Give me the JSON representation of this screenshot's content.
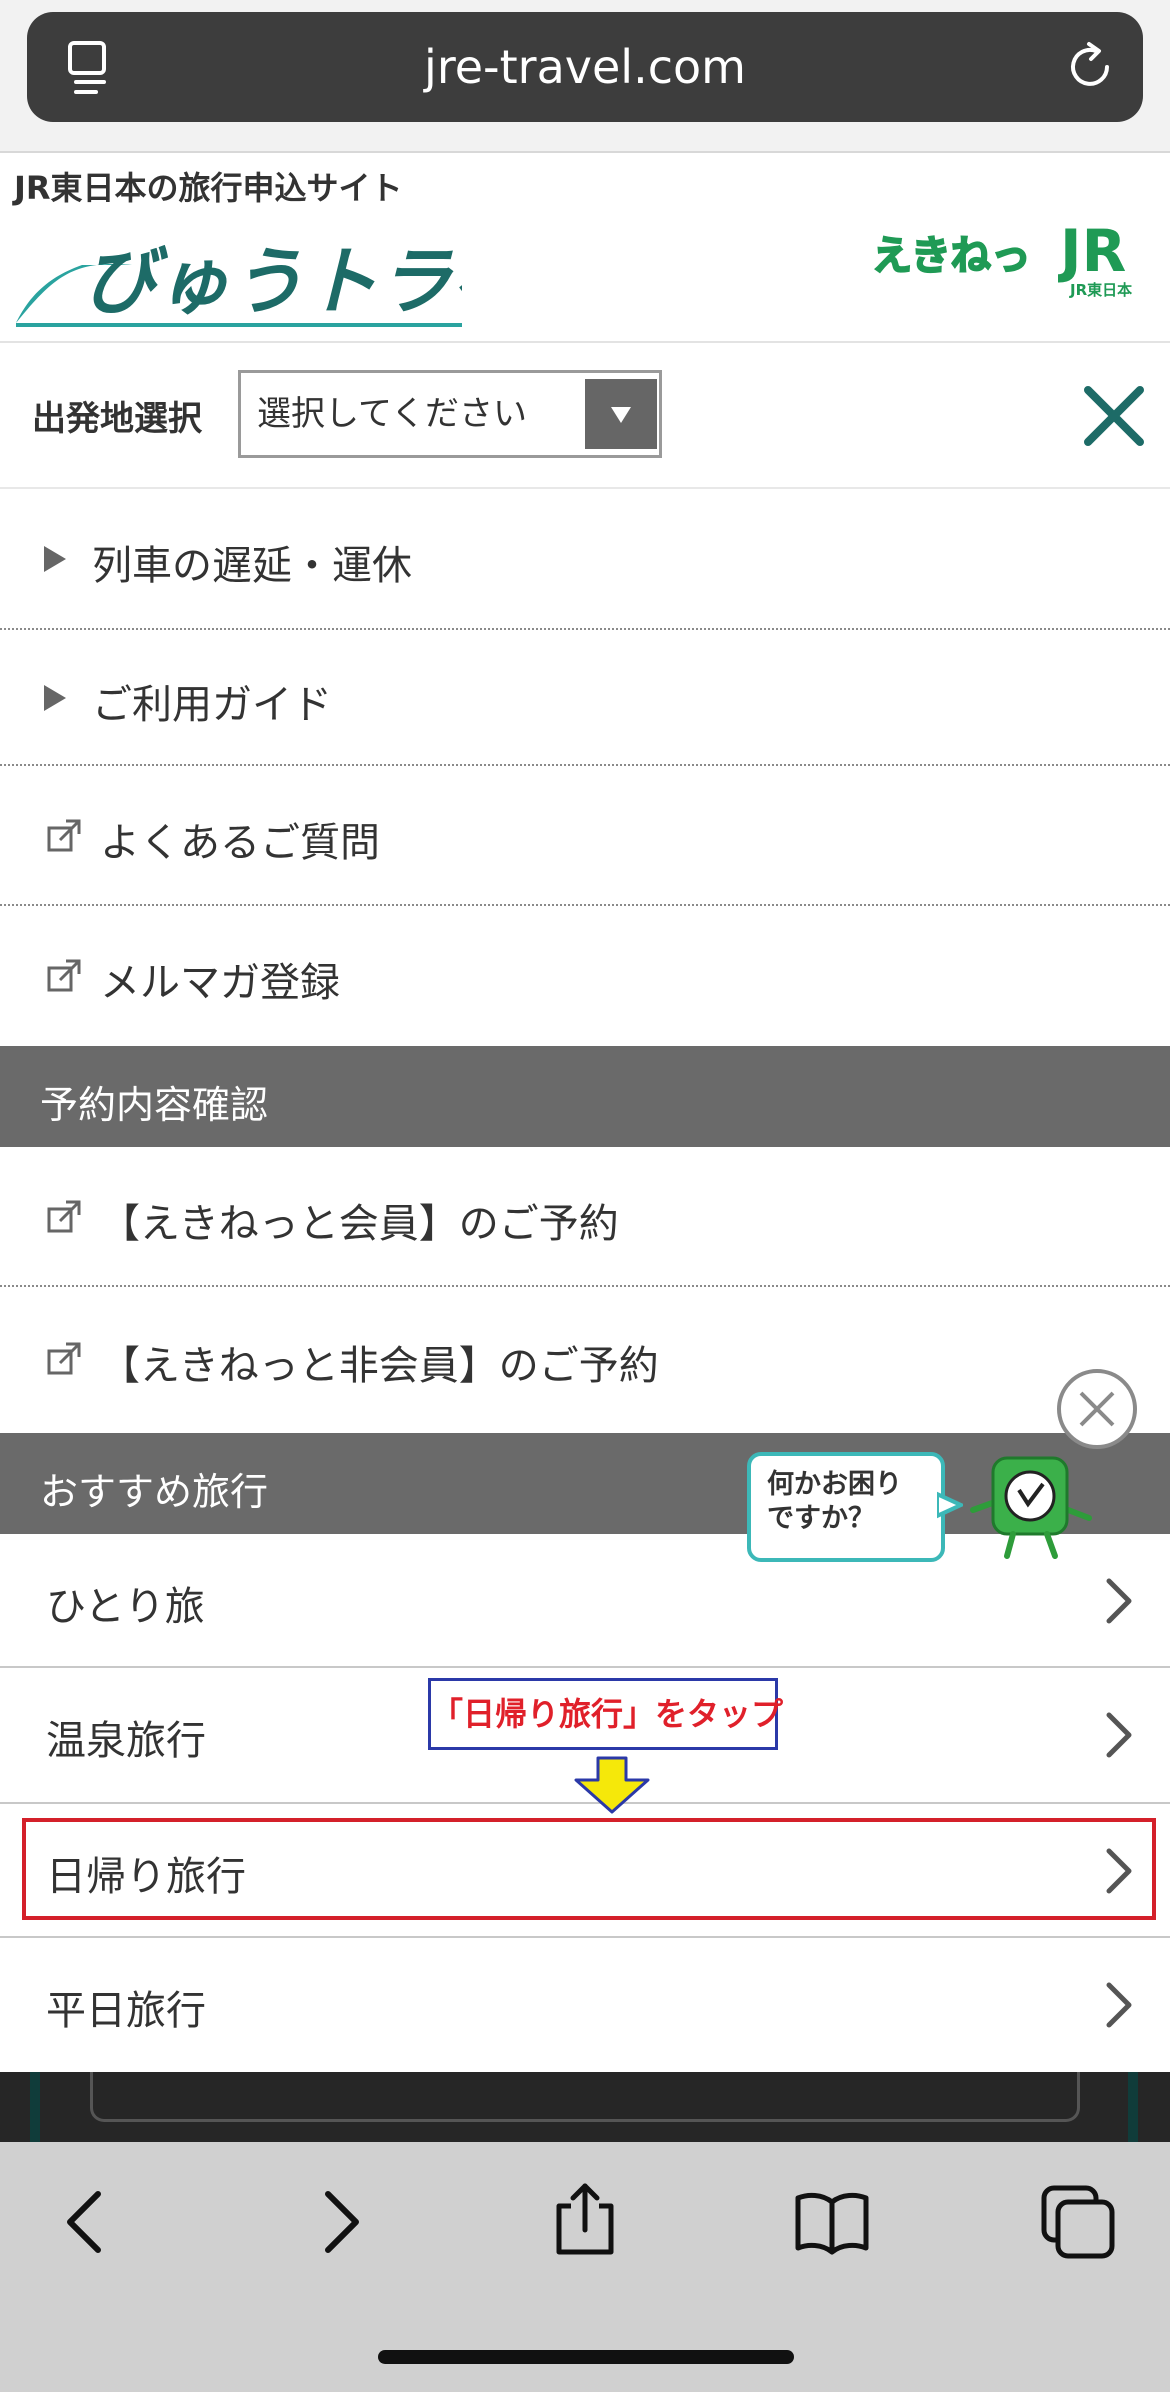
{
  "browser": {
    "url": "jre-travel.com"
  },
  "site_header": {
    "tagline": "JR東日本の旅行申込サイト",
    "logo_text": "びゅうトラベル",
    "ekinet_logo_text": "えきねっと",
    "jr_logo_text": "JR",
    "jr_logo_sub": "JR東日本"
  },
  "departure": {
    "label": "出発地選択",
    "select_value": "選択してください"
  },
  "menu_links": [
    {
      "label": "列車の遅延・運休",
      "icon": "triangle-right-icon"
    },
    {
      "label": "ご利用ガイド",
      "icon": "triangle-right-icon"
    },
    {
      "label": "よくあるご質問",
      "icon": "external-link-icon"
    },
    {
      "label": "メルマガ登録",
      "icon": "external-link-icon"
    }
  ],
  "reservation_section": {
    "title": "予約内容確認",
    "items": [
      {
        "label": "【えきねっと会員】のご予約",
        "icon": "external-link-icon"
      },
      {
        "label": "【えきねっと非会員】のご予約",
        "icon": "external-link-icon"
      }
    ]
  },
  "recommend_section": {
    "title": "おすすめ旅行",
    "items": [
      {
        "label": "ひとり旅",
        "icon": "chevron-right-icon"
      },
      {
        "label": "温泉旅行",
        "icon": "chevron-right-icon"
      },
      {
        "label": "日帰り旅行",
        "icon": "chevron-right-icon"
      },
      {
        "label": "平日旅行",
        "icon": "chevron-right-icon"
      }
    ]
  },
  "annotation": {
    "label": "「日帰り旅行」をタップ",
    "label_color": "#e0202a",
    "highlight_color": "#d4202a"
  },
  "help_widget": {
    "bubble_line1": "何かお困り",
    "bubble_line2": "ですか？"
  },
  "toolbar": {
    "icons": [
      "back-icon",
      "forward-icon",
      "share-icon",
      "bookmarks-icon",
      "tabs-icon"
    ]
  },
  "colors": {
    "accent_teal": "#1d6b67",
    "section_bar": "#6a6a6a",
    "ekinet_green": "#1f9a55",
    "jr_green": "#1f9a55"
  }
}
